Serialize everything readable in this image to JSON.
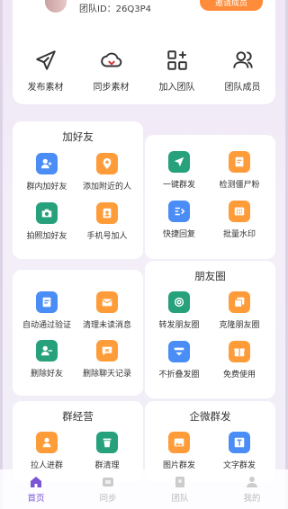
{
  "header": {
    "team_id": "团队ID：26Q3P4",
    "button_label": "邀请成员"
  },
  "top_actions": [
    {
      "label": "发布素材",
      "icon": "send-icon"
    },
    {
      "label": "同步素材",
      "icon": "cloud-sync-icon"
    },
    {
      "label": "加入团队",
      "icon": "grid-plus-icon"
    },
    {
      "label": "团队成员",
      "icon": "members-icon"
    }
  ],
  "sections": {
    "add_friends": {
      "title": "加好友",
      "items": [
        {
          "label": "群内加好友",
          "icon": "group-add-icon",
          "color": "#4a8df6"
        },
        {
          "label": "添加附近的人",
          "icon": "location-icon",
          "color": "#ff9c3a"
        },
        {
          "label": "拍照加好友",
          "icon": "camera-icon",
          "color": "#26a17b"
        },
        {
          "label": "手机号加人",
          "icon": "phone-contact-icon",
          "color": "#ff9c3a"
        }
      ]
    },
    "mass_send": {
      "items": [
        {
          "label": "一键群发",
          "icon": "send-icon",
          "color": "#26a17b"
        },
        {
          "label": "检测僵尸粉",
          "icon": "scan-icon",
          "color": "#ff9c3a"
        },
        {
          "label": "快捷回复",
          "icon": "reply-icon",
          "color": "#4a8df6"
        },
        {
          "label": "批量水印",
          "icon": "stamp-icon",
          "color": "#ff9c3a"
        }
      ]
    },
    "moments": {
      "title": "朋友圈",
      "items": [
        {
          "label": "转发朋友圈",
          "icon": "aperture-icon",
          "color": "#26a17b"
        },
        {
          "label": "克隆朋友圈",
          "icon": "clone-icon",
          "color": "#ff9c3a"
        },
        {
          "label": "不折叠发圈",
          "icon": "unfold-icon",
          "color": "#4a8df6"
        },
        {
          "label": "免费使用",
          "icon": "gift-icon",
          "color": "#ff9c3a"
        }
      ]
    },
    "misc": {
      "items": [
        {
          "label": "自动通过验证",
          "icon": "verify-icon",
          "color": "#4a8df6"
        },
        {
          "label": "清理未读消息",
          "icon": "mail-icon",
          "color": "#ff9c3a"
        },
        {
          "label": "删除好友",
          "icon": "remove-friend-icon",
          "color": "#26a17b"
        },
        {
          "label": "删除聊天记录",
          "icon": "delete-chat-icon",
          "color": "#ff9c3a"
        }
      ]
    },
    "group_ops": {
      "title": "群经营",
      "items": [
        {
          "label": "拉人进群",
          "icon": "pull-in-icon",
          "color": "#ff9c3a"
        },
        {
          "label": "群清理",
          "icon": "trash-icon",
          "color": "#26a17b"
        }
      ]
    },
    "wework_send": {
      "title": "企微群发",
      "items": [
        {
          "label": "图片群发",
          "icon": "image-icon",
          "color": "#ff9c3a"
        },
        {
          "label": "文字群发",
          "icon": "text-icon",
          "color": "#4a8df6"
        }
      ]
    }
  },
  "bottom_nav": [
    {
      "label": "首页",
      "icon": "home-icon",
      "active": true
    },
    {
      "label": "同步",
      "icon": "sync-icon",
      "active": false
    },
    {
      "label": "团队",
      "icon": "team-icon",
      "active": false
    },
    {
      "label": "我的",
      "icon": "profile-icon",
      "active": false
    }
  ],
  "colors": {
    "accent": "#7b55d6",
    "blue": "#4a8df6",
    "orange": "#ff9c3a",
    "green": "#26a17b"
  }
}
